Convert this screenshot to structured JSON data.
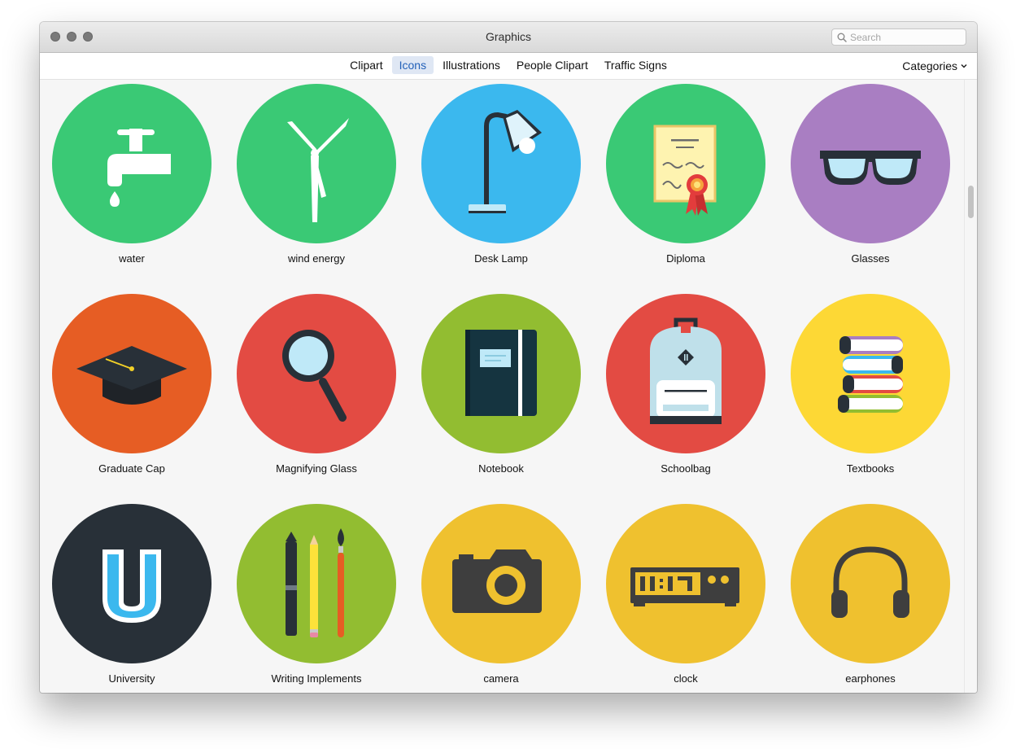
{
  "window": {
    "title": "Graphics"
  },
  "search": {
    "placeholder": "Search"
  },
  "tabs": [
    {
      "label": "Clipart",
      "active": false
    },
    {
      "label": "Icons",
      "active": true
    },
    {
      "label": "Illustrations",
      "active": false
    },
    {
      "label": "People Clipart",
      "active": false
    },
    {
      "label": "Traffic Signs",
      "active": false
    }
  ],
  "categories": {
    "label": "Categories"
  },
  "colors": {
    "accent": "#2361b9",
    "green": "#3ac975",
    "blue": "#3bb8ee",
    "purple": "#a97ec2",
    "orange": "#e65d24",
    "red": "#e34b43",
    "olive": "#92bd31",
    "yellow": "#fdd835",
    "dark": "#283038",
    "gold": "#efc12f"
  },
  "icons": [
    {
      "label": "water",
      "icon": "water-tap-icon",
      "bg": "#3ac975"
    },
    {
      "label": "wind energy",
      "icon": "wind-turbine-icon",
      "bg": "#3ac975"
    },
    {
      "label": "Desk Lamp",
      "icon": "desk-lamp-icon",
      "bg": "#3bb8ee"
    },
    {
      "label": "Diploma",
      "icon": "diploma-icon",
      "bg": "#3ac975"
    },
    {
      "label": "Glasses",
      "icon": "glasses-icon",
      "bg": "#a97ec2"
    },
    {
      "label": "Graduate Cap",
      "icon": "graduate-cap-icon",
      "bg": "#e65d24"
    },
    {
      "label": "Magnifying Glass",
      "icon": "magnifying-glass-icon",
      "bg": "#e34b43"
    },
    {
      "label": "Notebook",
      "icon": "notebook-icon",
      "bg": "#92bd31"
    },
    {
      "label": "Schoolbag",
      "icon": "schoolbag-icon",
      "bg": "#e34b43"
    },
    {
      "label": "Textbooks",
      "icon": "textbooks-icon",
      "bg": "#fdd835"
    },
    {
      "label": "University",
      "icon": "university-icon",
      "bg": "#283038"
    },
    {
      "label": "Writing Implements",
      "icon": "writing-implements-icon",
      "bg": "#92bd31"
    },
    {
      "label": "camera",
      "icon": "camera-icon",
      "bg": "#efc12f"
    },
    {
      "label": "clock",
      "icon": "digital-clock-icon",
      "bg": "#efc12f"
    },
    {
      "label": "earphones",
      "icon": "earphones-icon",
      "bg": "#efc12f"
    }
  ]
}
